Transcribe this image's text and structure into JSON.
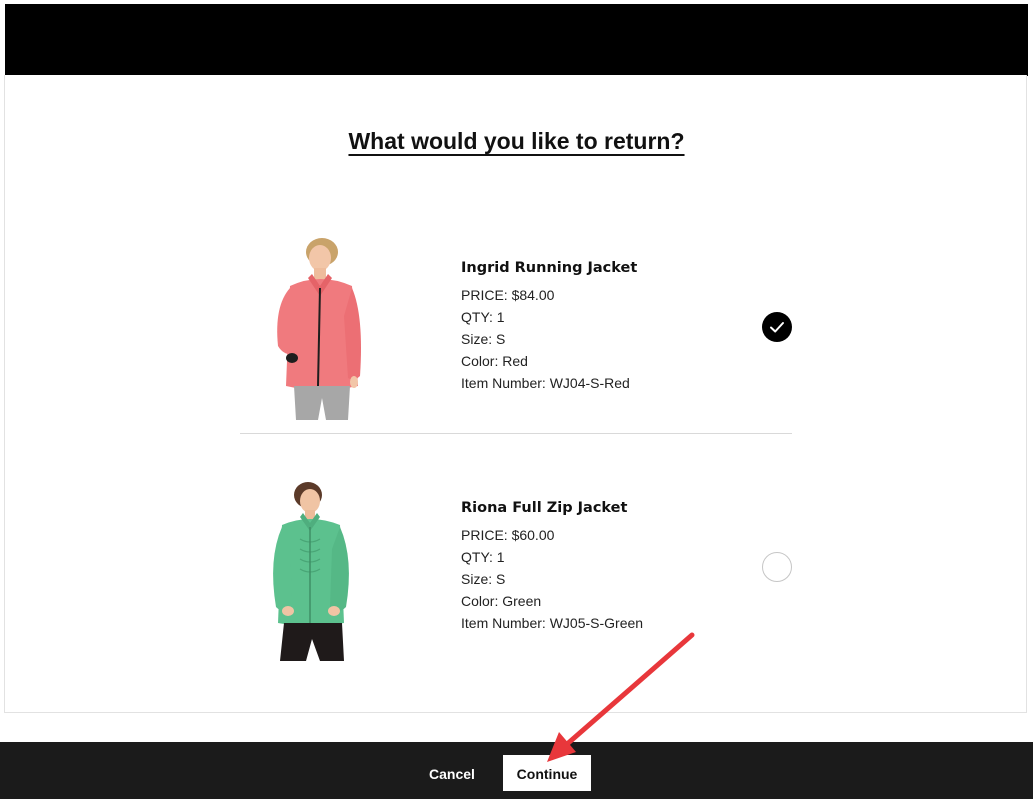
{
  "page": {
    "title": "What would you like to return?"
  },
  "items": [
    {
      "name": "Ingrid Running Jacket",
      "price": "PRICE: $84.00",
      "qty": "QTY: 1",
      "size": "Size: S",
      "color": "Color: Red",
      "item_number": "Item Number: WJ04-S-Red",
      "selected": true,
      "jacket_color": "#f07a7e"
    },
    {
      "name": "Riona Full Zip Jacket",
      "price": "PRICE: $60.00",
      "qty": "QTY: 1",
      "size": "Size: S",
      "color": "Color: Green",
      "item_number": "Item Number: WJ05-S-Green",
      "selected": false,
      "jacket_color": "#5cc18e"
    }
  ],
  "footer": {
    "cancel_label": "Cancel",
    "continue_label": "Continue"
  },
  "colors": {
    "header": "#000000",
    "footer": "#1b1b1b",
    "annotation_arrow": "#e8373b"
  }
}
